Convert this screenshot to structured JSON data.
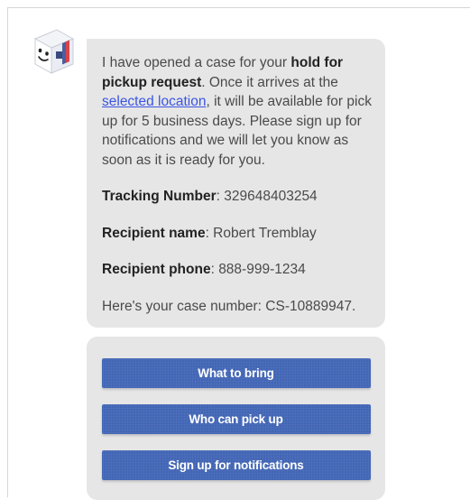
{
  "message": {
    "intro_1": "I have opened a case for your ",
    "intro_bold": "hold for pickup request",
    "intro_2": ". Once it arrives at the ",
    "link_text": "selected location",
    "intro_3": ", it will be available for pick up for 5 business days. Please sign up for notifications and we will let you know as soon as it is ready for you.",
    "tracking_label": "Tracking Number",
    "tracking_value": ": 329648403254",
    "recipient_name_label": "Recipient name",
    "recipient_name_value": ": Robert Tremblay",
    "recipient_phone_label": "Recipient phone",
    "recipient_phone_value": ": 888-999-1234",
    "case_text": "Here's your case number: CS-10889947."
  },
  "actions": {
    "what_to_bring": "What to bring",
    "who_can_pick_up": "Who can pick up",
    "sign_up": "Sign up for notifications"
  },
  "colors": {
    "button": "#3f63b4",
    "bubble": "#e6e6e6",
    "link": "#3b56e4"
  },
  "icons": {
    "avatar": "box-mascot-avatar"
  }
}
